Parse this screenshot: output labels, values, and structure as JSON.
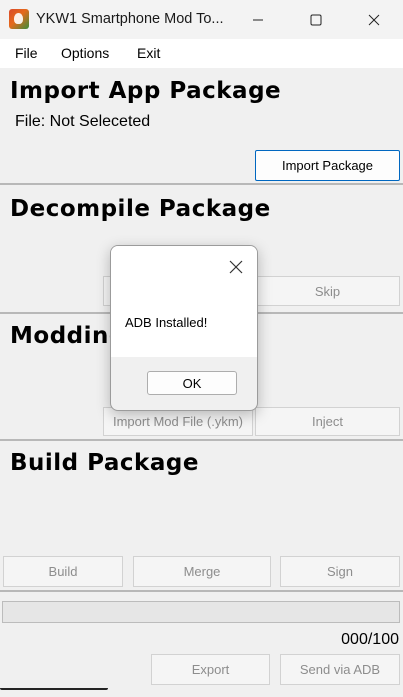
{
  "window": {
    "title": "YKW1 Smartphone Mod To...",
    "icon": "app-icon",
    "controls": [
      "minimize-icon",
      "maximize-icon",
      "close-icon"
    ]
  },
  "menu": {
    "file": "File",
    "options": "Options",
    "exit": "Exit"
  },
  "import": {
    "heading": "Import App Package",
    "file_status": "File: Not Seleceted",
    "button": "Import Package"
  },
  "decompile": {
    "heading": "Decompile Package",
    "skip_button": "Skip"
  },
  "modding": {
    "heading": "Modding",
    "import_mod_button": "Import Mod File (.ykm)",
    "inject_button": "Inject"
  },
  "build": {
    "heading": "Build Package",
    "build_button": "Build",
    "merge_button": "Merge",
    "sign_button": "Sign"
  },
  "progress": {
    "value": 0,
    "max": 100,
    "label": "000/100",
    "fill_color": "#06b025"
  },
  "bottom": {
    "export_button": "Export",
    "send_button": "Send via ADB"
  },
  "dialog": {
    "message": "ADB Installed!",
    "ok_button": "OK"
  },
  "colors": {
    "accent": "#0067c0",
    "background": "#f0f0f0"
  }
}
